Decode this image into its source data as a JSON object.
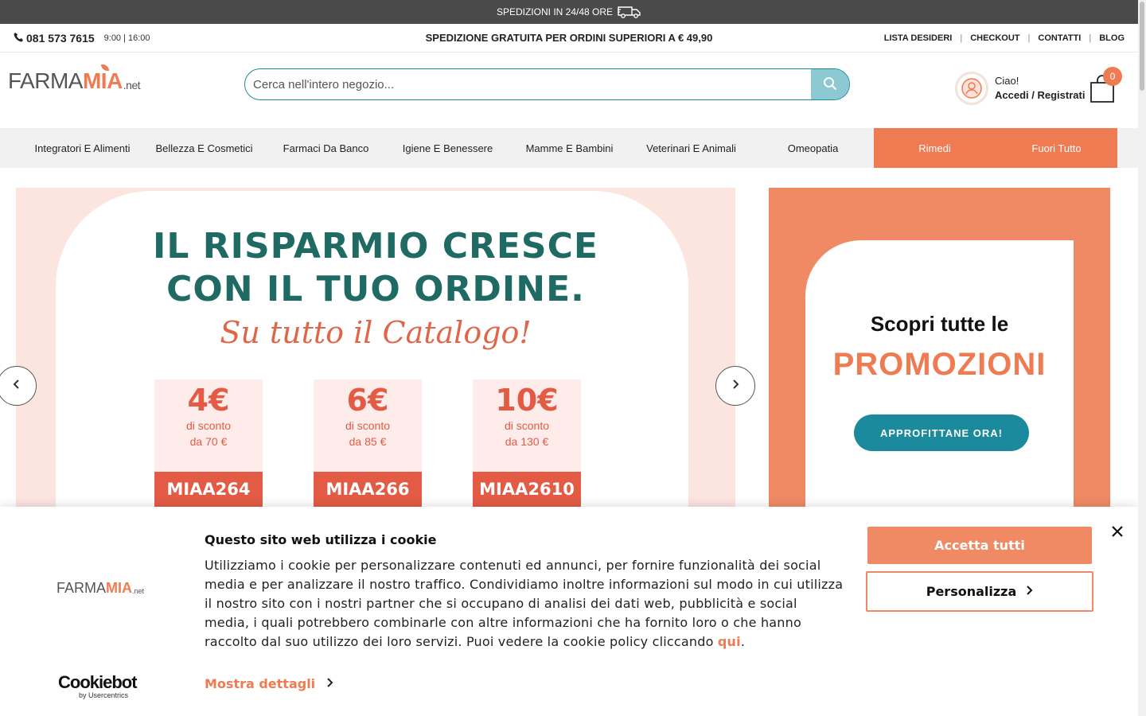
{
  "announcement": {
    "text": "SPEDIZIONI IN 24/48 ORE",
    "icon": "truck-icon"
  },
  "topbar": {
    "phone": "081 573 7615",
    "hours": "9:00 | 16:00",
    "promo": "SPEDIZIONE GRATUITA PER ORDINI SUPERIORI A € 49,90",
    "links": [
      "LISTA DESIDERI",
      "CHECKOUT",
      "CONTATTI",
      "BLOG"
    ]
  },
  "header": {
    "logo": {
      "farma": "FARMA",
      "mia": "MIA",
      "net": ".net"
    },
    "search_placeholder": "Cerca nell'intero negozio...",
    "account": {
      "greeting": "Ciao!",
      "login": "Accedi / Registrati"
    },
    "cart_count": "0"
  },
  "nav": {
    "items": [
      "Integratori E Alimenti",
      "Bellezza E Cosmetici",
      "Farmaci Da Banco",
      "Igiene E Benessere",
      "Mamme E Bambini",
      "Veterinari E Animali",
      "Omeopatia",
      "Rimedi",
      "Fuori Tutto"
    ]
  },
  "slider": {
    "line1": "IL RISPARMIO CRESCE",
    "line2": "CON IL TUO ORDINE.",
    "script": "Su tutto il Catalogo!",
    "coupons": [
      {
        "amount": "4€",
        "label1": "di sconto",
        "label2": "da 70 €",
        "code": "MIAA264"
      },
      {
        "amount": "6€",
        "label1": "di sconto",
        "label2": "da 85 €",
        "code": "MIAA266"
      },
      {
        "amount": "10€",
        "label1": "di sconto",
        "label2": "da 130 €",
        "code": "MIAA2610"
      }
    ]
  },
  "promo": {
    "line1": "Scopri tutte le",
    "line2": "PROMOZIONI",
    "cta": "APPROFITTANE ORA!"
  },
  "cookie": {
    "logo": {
      "farma": "FARMA",
      "mia": "MIA",
      "net": ".net"
    },
    "brand": "Cookiebot",
    "brand_by": "by Usercentrics",
    "title": "Questo sito web utilizza i cookie",
    "body": "Utilizziamo i cookie per personalizzare contenuti ed annunci, per fornire funzionalità dei social media e per analizzare il nostro traffico. Condividiamo inoltre informazioni sul modo in cui utilizza il nostro sito con i nostri partner che si occupano di analisi dei dati web, pubblicità e social media, i quali potrebbero combinarle con altre informazioni che ha fornito loro o che hanno raccolto dal suo utilizzo dei loro servizi. Puoi vedere la cookie policy cliccando",
    "link": "qui",
    "details": "Mostra dettagli",
    "accept": "Accetta tutti",
    "customize": "Personalizza"
  },
  "colors": {
    "accent": "#ef7b52",
    "teal": "#1a8a9c",
    "dark_bar": "#4a4a4a",
    "nav_bg": "#f1f1f1"
  }
}
